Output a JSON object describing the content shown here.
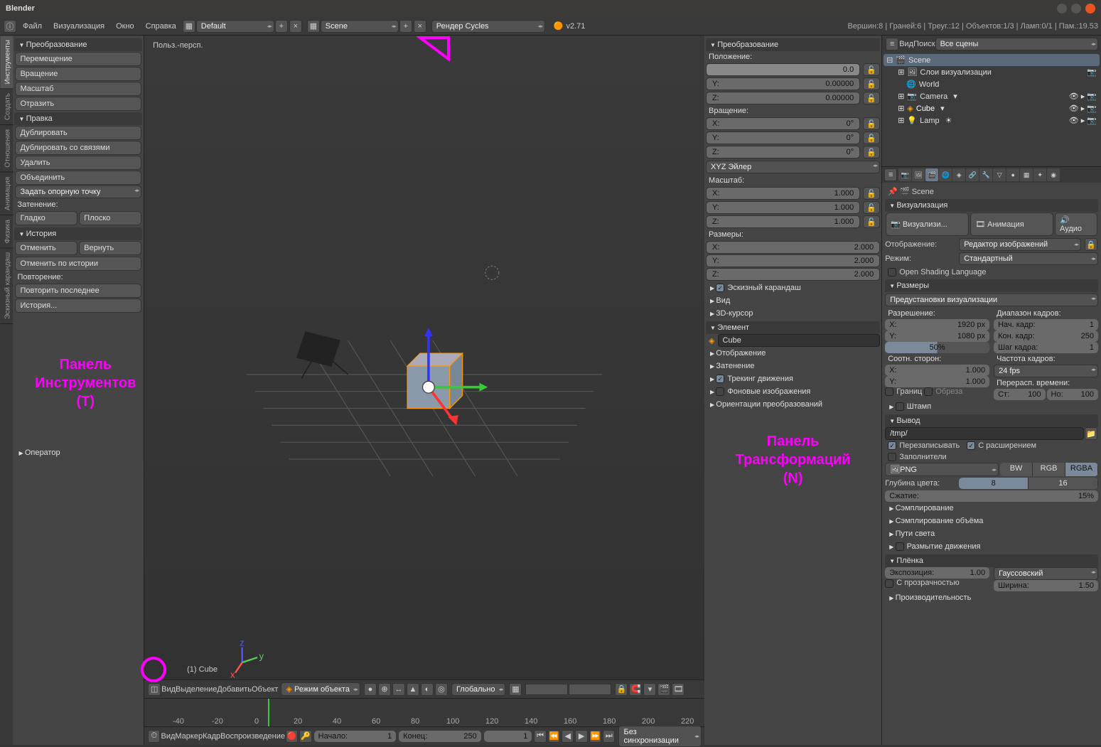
{
  "window": {
    "title": "Blender"
  },
  "top_menu": [
    "Файл",
    "Визуализация",
    "Окно",
    "Справка"
  ],
  "layout_selector": "Default",
  "scene_selector": "Scene",
  "render_engine": "Рендер Cycles",
  "version": "v2.71",
  "status": "Вершин:8 | Граней:6 | Треуг.:12 | Объектов:1/3 | Ламп:0/1 | Пам.:19.53",
  "annotations": {
    "tool_panel": "Панель\nИнструментов\n(T)",
    "n_panel": "Панель\nТрансформаций\n(N)"
  },
  "tools": {
    "transform": {
      "header": "Преобразование",
      "items": [
        "Перемещение",
        "Вращение",
        "Масштаб",
        "Отразить"
      ]
    },
    "edit": {
      "header": "Правка",
      "dup": "Дублировать",
      "dup_link": "Дублировать со связями",
      "del": "Удалить",
      "join": "Объединить",
      "origin": "Задать опорную точку",
      "shading_lbl": "Затенение:",
      "smooth": "Гладко",
      "flat": "Плоско"
    },
    "history": {
      "header": "История",
      "undo": "Отменить",
      "redo": "Вернуть",
      "undo_hist": "Отменить по истории",
      "repeat_lbl": "Повторение:",
      "repeat_last": "Повторить последнее",
      "hist": "История..."
    },
    "operator": "Оператор"
  },
  "vtabs": [
    "Инструменты",
    "Создать",
    "Отношения",
    "Анимация",
    "Физика",
    "Эскизный карандаш"
  ],
  "viewport": {
    "persp": "Польз.-персп.",
    "obj": "(1) Cube"
  },
  "vp_menu": [
    "Вид",
    "Выделение",
    "Добавить",
    "Объект"
  ],
  "vp_mode": "Режим объекта",
  "vp_orient": "Глобально",
  "timeline_menu": [
    "Вид",
    "Маркер",
    "Кадр",
    "Воспроизведение"
  ],
  "timeline": {
    "start_lbl": "Начало:",
    "start": "1",
    "end_lbl": "Конец:",
    "end": "250",
    "cur": "1",
    "sync": "Без синхронизации"
  },
  "n": {
    "header": "Преобразование",
    "loc": {
      "lbl": "Положение:",
      "x": "0.0",
      "y": "0.00000",
      "z": "0.00000"
    },
    "rot": {
      "lbl": "Вращение:",
      "x": "0°",
      "y": "0°",
      "z": "0°",
      "mode": "XYZ Эйлер"
    },
    "scale": {
      "lbl": "Масштаб:",
      "x": "1.000",
      "y": "1.000",
      "z": "1.000"
    },
    "dim": {
      "lbl": "Размеры:",
      "x": "2.000",
      "y": "2.000",
      "z": "2.000"
    },
    "sections": [
      "Эскизный карандаш",
      "Вид",
      "3D-курсор"
    ],
    "item": {
      "header": "Элемент",
      "name": "Cube"
    },
    "sections2": [
      "Отображение",
      "Затенение",
      "Трекинг движения",
      "Фоновые изображения",
      "Ориентации преобразований"
    ]
  },
  "outliner": {
    "menu": [
      "Вид",
      "Поиск"
    ],
    "filter": "Все сцены",
    "tree": [
      {
        "name": "Scene",
        "icon": "🎬",
        "indent": 0,
        "sel": true
      },
      {
        "name": "Слои визуализации",
        "icon": "🖼",
        "indent": 1
      },
      {
        "name": "World",
        "icon": "🌐",
        "indent": 1
      },
      {
        "name": "Camera",
        "icon": "📷",
        "indent": 1
      },
      {
        "name": "Cube",
        "icon": "◈",
        "indent": 1
      },
      {
        "name": "Lamp",
        "icon": "💡",
        "indent": 1
      }
    ]
  },
  "props": {
    "breadcrumb": "Scene",
    "render": {
      "header": "Визуализация",
      "buttons": {
        "render": "Визуализи...",
        "anim": "Анимация",
        "audio": "Аудио"
      },
      "display_lbl": "Отображение:",
      "display": "Редактор изображений",
      "mode_lbl": "Режим:",
      "mode": "Стандартный",
      "osl": "Open Shading Language"
    },
    "dimensions": {
      "header": "Размеры",
      "preset": "Предустановки визуализации",
      "res_lbl": "Разрешение:",
      "res_x": "1920 px",
      "res_y": "1080 px",
      "res_pct": "50%",
      "range_lbl": "Диапазон кадров:",
      "start_lbl": "Нач. кадр:",
      "start": "1",
      "end_lbl": "Кон. кадр:",
      "end": "250",
      "step_lbl": "Шаг кадра:",
      "step": "1",
      "aspect_lbl": "Соотн. сторон:",
      "ax": "1.000",
      "ay": "1.000",
      "fps_lbl": "Частота кадров:",
      "fps": "24 fps",
      "remap_lbl": "Перерасп. времени:",
      "old_lbl": "Ст:",
      "old": "100",
      "new_lbl": "Но:",
      "new": "100",
      "border": "Границ",
      "crop": "Обреза"
    },
    "stamp": "Штамп",
    "output": {
      "header": "Вывод",
      "path": "/tmp/",
      "overwrite": "Перезаписывать",
      "ext": "С расширением",
      "placeholders": "Заполнители",
      "format": "PNG",
      "modes": [
        "BW",
        "RGB",
        "RGBA"
      ],
      "depth_lbl": "Глубина цвета:",
      "depths": [
        "8",
        "16"
      ],
      "comp_lbl": "Сжатие:",
      "comp": "15%"
    },
    "sections": [
      "Сэмплирование",
      "Сэмплирование объёма",
      "Пути света",
      "Размытие движения"
    ],
    "film": {
      "header": "Плёнка",
      "exp_lbl": "Экспозиция:",
      "exp": "1.00",
      "filter": "Гауссовский",
      "transp": "С прозрачностью",
      "width_lbl": "Ширина:",
      "width": "1.50"
    },
    "perf": "Производительность"
  }
}
